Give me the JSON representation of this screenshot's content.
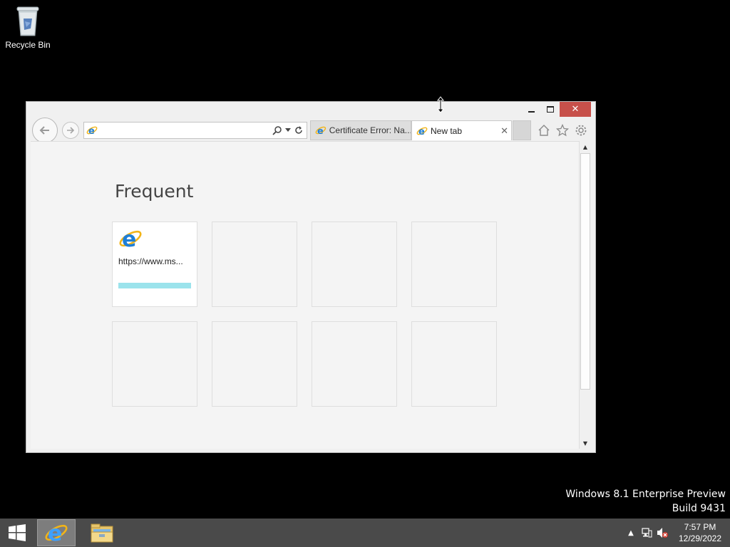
{
  "desktop": {
    "recycle_bin_label": "Recycle Bin",
    "watermark_line1": "Windows 8.1 Enterprise Preview",
    "watermark_line2": "Build 9431"
  },
  "browser": {
    "window_controls": {
      "minimize": "minimize-icon",
      "maximize": "maximize-icon",
      "close": "close-icon"
    },
    "address_bar": {
      "value": "",
      "placeholder": ""
    },
    "tabs": [
      {
        "title": "Certificate Error: Na...",
        "active": false
      },
      {
        "title": "New tab",
        "active": true,
        "close": "✕"
      }
    ],
    "page": {
      "heading": "Frequent",
      "tiles": [
        {
          "url": "https://www.ms...",
          "filled": true
        },
        {
          "url": "",
          "filled": false
        },
        {
          "url": "",
          "filled": false
        },
        {
          "url": "",
          "filled": false
        },
        {
          "url": "",
          "filled": false
        },
        {
          "url": "",
          "filled": false
        },
        {
          "url": "",
          "filled": false
        },
        {
          "url": "",
          "filled": false
        }
      ]
    },
    "colors": {
      "close_button": "#c7504a",
      "tile_bar": "#9be3ec",
      "ie_blue": "#1f7fd6",
      "ie_ring": "#f2b417"
    }
  },
  "taskbar": {
    "clock_time": "7:57 PM",
    "clock_date": "12/29/2022",
    "apps": [
      "internet-explorer",
      "file-explorer"
    ],
    "tray": [
      "show-hidden-icons",
      "network-icon",
      "volume-muted-icon"
    ]
  }
}
